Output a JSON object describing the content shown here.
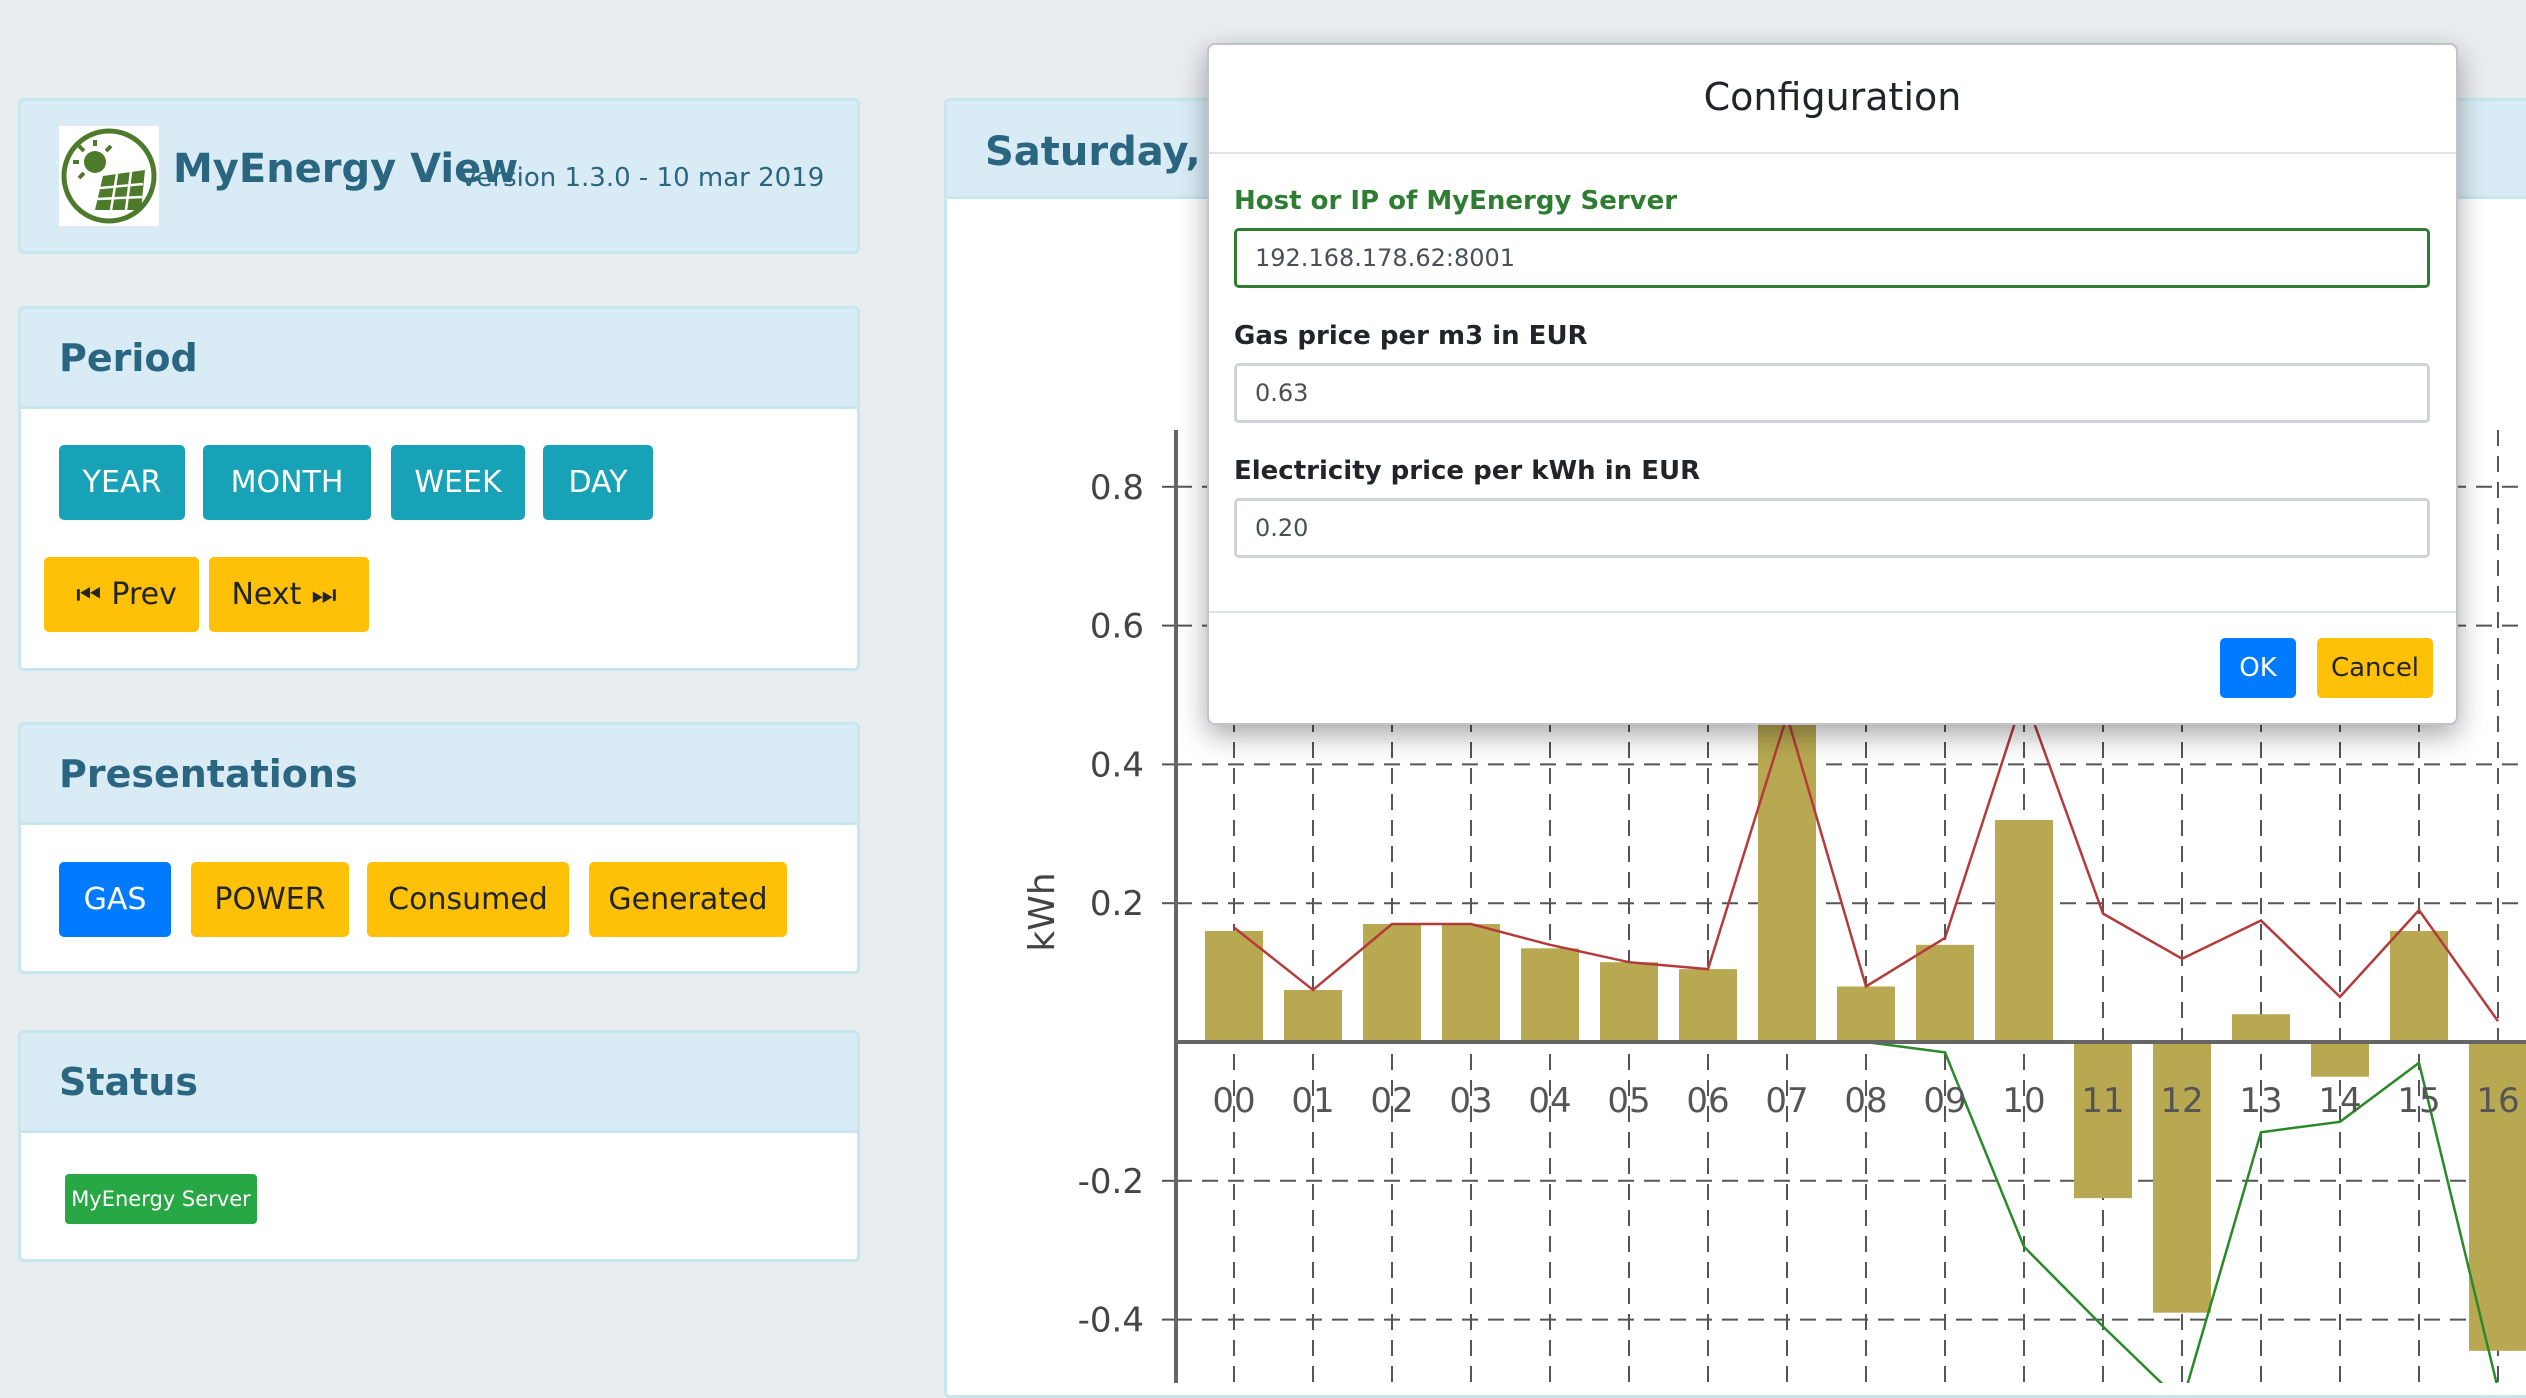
{
  "app": {
    "title": "MyEnergy View",
    "version": "version 1.3.0 - 10 mar 2019"
  },
  "period": {
    "header": "Period",
    "buttons": [
      "YEAR",
      "MONTH",
      "WEEK",
      "DAY"
    ],
    "prev_label": "Prev",
    "next_label": "Next"
  },
  "presentations": {
    "header": "Presentations",
    "buttons": [
      "GAS",
      "POWER",
      "Consumed",
      "Generated"
    ]
  },
  "status": {
    "header": "Status",
    "badge": "MyEnergy Server"
  },
  "main": {
    "header_title": "Saturday, Ma"
  },
  "chart_data": {
    "type": "bar",
    "ylabel": "kWh",
    "ylim": [
      -0.5,
      0.85
    ],
    "yticks": [
      "0.8",
      "0.6",
      "0.4",
      "0.2",
      "-0.2",
      "-0.4"
    ],
    "categories": [
      "00",
      "01",
      "02",
      "03",
      "04",
      "05",
      "06",
      "07",
      "08",
      "09",
      "10",
      "11",
      "12",
      "13",
      "14",
      "15",
      "16"
    ],
    "series": [
      {
        "values": [
          0.16,
          0.075,
          0.17,
          0.17,
          0.135,
          0.115,
          0.105,
          0.47,
          0.08,
          0.14,
          0.32,
          -0.225,
          -0.39,
          0.04,
          -0.05,
          0.16,
          -0.445
        ]
      },
      {
        "values": [
          0.165,
          0.075,
          0.17,
          0.17,
          0.14,
          0.115,
          0.105,
          0.47,
          0.08,
          0.15,
          0.5,
          0.185,
          0.12,
          0.175,
          0.065,
          0.19,
          0.03
        ]
      },
      {
        "values": [
          0,
          0,
          0,
          0,
          0,
          0,
          0,
          0,
          0,
          -0.015,
          -0.295,
          -0.41,
          -0.52,
          -0.13,
          -0.115,
          -0.03,
          -0.5
        ]
      }
    ],
    "colors": {
      "bars": "#b8a852",
      "line1": "#b53a3a",
      "line2": "#2a8a2a"
    },
    "grid": true
  },
  "modal": {
    "title": "Configuration",
    "fields": [
      {
        "label": "Host or IP of MyEnergy Server",
        "value": "192.168.178.62:8001"
      },
      {
        "label": "Gas price per m3 in EUR",
        "value": "0.63"
      },
      {
        "label": "Electricity price per kWh in EUR",
        "value": "0.20"
      }
    ],
    "ok_label": "OK",
    "cancel_label": "Cancel"
  }
}
